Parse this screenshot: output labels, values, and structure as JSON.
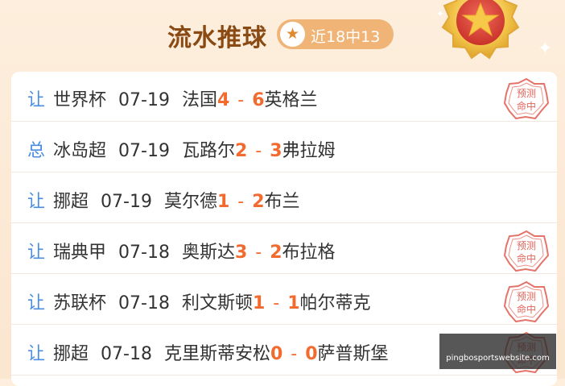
{
  "header": {
    "title": "流水推球",
    "badge_icon": "star-icon",
    "badge_text": "近18中13",
    "medal_icon": "gold-star-medal-icon"
  },
  "stamp": {
    "icon": "hit-stamp-icon",
    "line1": "预测",
    "line2": "命中"
  },
  "rows": [
    {
      "type": "让",
      "league": "世界杯",
      "date": "07-19",
      "home": "法国",
      "home_score": "4",
      "sep": "-",
      "away_score": "6",
      "away": "英格兰",
      "stamp": true
    },
    {
      "type": "总",
      "league": "冰岛超",
      "date": "07-19",
      "home": "瓦路尔",
      "home_score": "2",
      "sep": "-",
      "away_score": "3",
      "away": "弗拉姆",
      "stamp": false
    },
    {
      "type": "让",
      "league": "挪超",
      "date": "07-19",
      "home": "莫尔德",
      "home_score": "1",
      "sep": "-",
      "away_score": "2",
      "away": "布兰",
      "stamp": false
    },
    {
      "type": "让",
      "league": "瑞典甲",
      "date": "07-18",
      "home": "奥斯达",
      "home_score": "3",
      "sep": "-",
      "away_score": "2",
      "away": "布拉格",
      "stamp": true
    },
    {
      "type": "让",
      "league": "苏联杯",
      "date": "07-18",
      "home": "利文斯顿",
      "home_score": "1",
      "sep": "-",
      "away_score": "1",
      "away": "帕尔蒂克",
      "stamp": true
    },
    {
      "type": "让",
      "league": "挪超",
      "date": "07-18",
      "home": "克里斯蒂安松",
      "home_score": "0",
      "sep": "-",
      "away_score": "0",
      "away": "萨普斯堡",
      "stamp": true
    }
  ],
  "watermark": {
    "line1": "",
    "line2": "pingbosportswebsite.com"
  },
  "colors": {
    "accent_score": "#f26a2e",
    "type_label": "#4a8de0",
    "title": "#8a4a14",
    "badge_bg": "#f0b477",
    "stamp": "#e2645a"
  }
}
